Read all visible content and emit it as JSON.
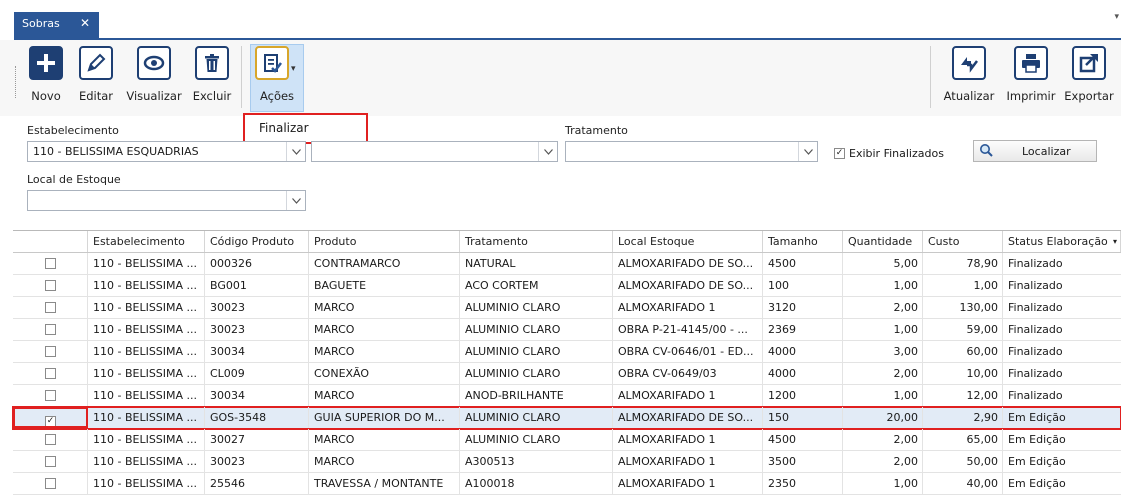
{
  "tab": {
    "title": "Sobras",
    "close": "✕"
  },
  "toolbar": {
    "novo": "Novo",
    "editar": "Editar",
    "visualizar": "Visualizar",
    "excluir": "Excluir",
    "acoes": "Ações",
    "atualizar": "Atualizar",
    "imprimir": "Imprimir",
    "exportar": "Exportar"
  },
  "acoes_menu": {
    "items": [
      "Finalizar"
    ]
  },
  "filters": {
    "estabelecimento_label": "Estabelecimento",
    "estabelecimento_value": "110 - BELISSIMA ESQUADRIAS",
    "produto_value": "",
    "tratamento_label": "Tratamento",
    "tratamento_value": "",
    "exibir_finalizados": "Exibir Finalizados",
    "exibir_checked": true,
    "localizar": "Localizar",
    "local_estoque_label": "Local de Estoque",
    "local_estoque_value": ""
  },
  "grid": {
    "columns": [
      "",
      "Estabelecimento",
      "Código Produto",
      "Produto",
      "Tratamento",
      "Local Estoque",
      "Tamanho",
      "Quantidade",
      "Custo",
      "Status Elaboração"
    ],
    "rows": [
      {
        "checked": false,
        "estab": "110 - BELISSIMA ...",
        "codigo": "000326",
        "produto": "CONTRAMARCO",
        "tratamento": "NATURAL",
        "local": "ALMOXARIFADO DE SO...",
        "tamanho": "4500",
        "quantidade": "5,00",
        "custo": "78,90",
        "status": "Finalizado"
      },
      {
        "checked": false,
        "estab": "110 - BELISSIMA ...",
        "codigo": "BG001",
        "produto": "BAGUETE",
        "tratamento": "ACO CORTEM",
        "local": "ALMOXARIFADO DE SO...",
        "tamanho": "100",
        "quantidade": "1,00",
        "custo": "1,00",
        "status": "Finalizado"
      },
      {
        "checked": false,
        "estab": "110 - BELISSIMA ...",
        "codigo": "30023",
        "produto": "MARCO",
        "tratamento": "ALUMINIO CLARO",
        "local": "ALMOXARIFADO 1",
        "tamanho": "3120",
        "quantidade": "2,00",
        "custo": "130,00",
        "status": "Finalizado"
      },
      {
        "checked": false,
        "estab": "110 - BELISSIMA ...",
        "codigo": "30023",
        "produto": "MARCO",
        "tratamento": "ALUMINIO CLARO",
        "local": "OBRA P-21-4145/00 - ...",
        "tamanho": "2369",
        "quantidade": "1,00",
        "custo": "59,00",
        "status": "Finalizado"
      },
      {
        "checked": false,
        "estab": "110 - BELISSIMA ...",
        "codigo": "30034",
        "produto": "MARCO",
        "tratamento": "ALUMINIO CLARO",
        "local": "OBRA CV-0646/01 - ED...",
        "tamanho": "4000",
        "quantidade": "3,00",
        "custo": "60,00",
        "status": "Finalizado"
      },
      {
        "checked": false,
        "estab": "110 - BELISSIMA ...",
        "codigo": "CL009",
        "produto": "CONEXÃO",
        "tratamento": "ALUMINIO CLARO",
        "local": "OBRA CV-0649/03",
        "tamanho": "4000",
        "quantidade": "2,00",
        "custo": "10,00",
        "status": "Finalizado"
      },
      {
        "checked": false,
        "estab": "110 - BELISSIMA ...",
        "codigo": "30034",
        "produto": "MARCO",
        "tratamento": "ANOD-BRILHANTE",
        "local": "ALMOXARIFADO 1",
        "tamanho": "1200",
        "quantidade": "1,00",
        "custo": "12,00",
        "status": "Finalizado"
      },
      {
        "checked": true,
        "estab": "110 - BELISSIMA ...",
        "codigo": "GOS-3548",
        "produto": "GUIA SUPERIOR DO M...",
        "tratamento": "ALUMINIO CLARO",
        "local": "ALMOXARIFADO DE SO...",
        "tamanho": "150",
        "quantidade": "20,00",
        "custo": "2,90",
        "status": "Em Edição"
      },
      {
        "checked": false,
        "estab": "110 - BELISSIMA ...",
        "codigo": "30027",
        "produto": "MARCO",
        "tratamento": "ALUMINIO CLARO",
        "local": "ALMOXARIFADO 1",
        "tamanho": "4500",
        "quantidade": "2,00",
        "custo": "65,00",
        "status": "Em Edição"
      },
      {
        "checked": false,
        "estab": "110 - BELISSIMA ...",
        "codigo": "30023",
        "produto": "MARCO",
        "tratamento": "A300513",
        "local": "ALMOXARIFADO 1",
        "tamanho": "3500",
        "quantidade": "2,00",
        "custo": "50,00",
        "status": "Em Edição"
      },
      {
        "checked": false,
        "estab": "110 - BELISSIMA ...",
        "codigo": "25546",
        "produto": "TRAVESSA / MONTANTE",
        "tratamento": "A100018",
        "local": "ALMOXARIFADO 1",
        "tamanho": "2350",
        "quantidade": "1,00",
        "custo": "40,00",
        "status": "Em Edição"
      }
    ]
  },
  "colors": {
    "accent": "#2b5797",
    "highlight": "#e02020",
    "selected_row": "#e2ebf6"
  }
}
